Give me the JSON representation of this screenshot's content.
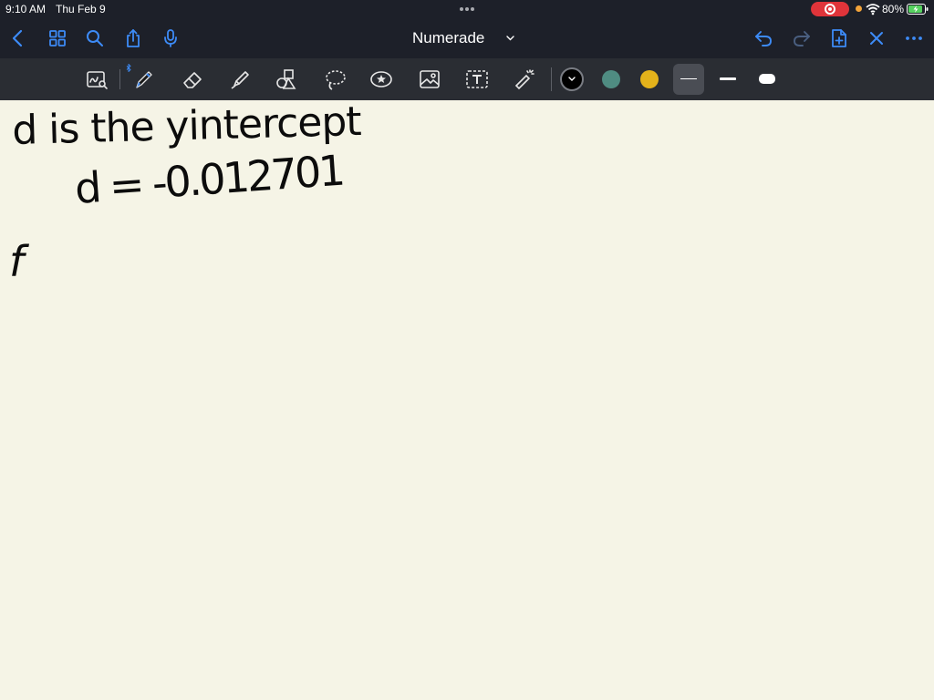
{
  "status_bar": {
    "time": "9:10 AM",
    "date": "Thu Feb 9",
    "battery_percent": "80%",
    "record_color": "#e0343a"
  },
  "nav_bar": {
    "title": "Numerade",
    "left_icons": [
      "back-chevron-icon",
      "grid-view-icon",
      "search-icon",
      "share-icon",
      "microphone-icon"
    ],
    "right_icons": [
      "undo-icon",
      "redo-icon",
      "add-page-icon",
      "close-icon",
      "more-icon"
    ],
    "accent_color": "#3d8bf7"
  },
  "tool_bar": {
    "tools": [
      "zoom-window-icon",
      "pen-icon",
      "eraser-icon",
      "highlighter-icon",
      "shapes-icon",
      "lasso-icon",
      "sticker-icon",
      "image-icon",
      "text-icon",
      "laser-pointer-icon"
    ],
    "colors": [
      "#000000",
      "#4f8c82",
      "#e3b21b"
    ],
    "selected_color": "#000000",
    "stroke_sizes": [
      "thin",
      "medium",
      "thick"
    ],
    "selected_size": "thin"
  },
  "canvas": {
    "handwriting": {
      "line1": "d is the yintercept",
      "line2": "d = -0.012701",
      "line3": "f"
    },
    "ink_color": "#0c0c0c"
  }
}
